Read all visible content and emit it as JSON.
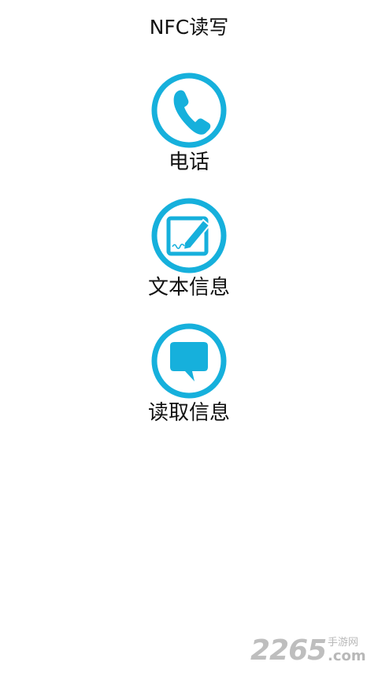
{
  "app": {
    "title": "NFC读写"
  },
  "menu": {
    "items": [
      {
        "label": "电话",
        "icon": "phone-icon"
      },
      {
        "label": "文本信息",
        "icon": "edit-note-icon"
      },
      {
        "label": "读取信息",
        "icon": "chat-bubble-icon"
      }
    ]
  },
  "watermark": {
    "number": "2265",
    "site": "手游网",
    "domain": ".com"
  },
  "colors": {
    "accent": "#16b0dc",
    "text": "#111111",
    "background": "#ffffff"
  }
}
